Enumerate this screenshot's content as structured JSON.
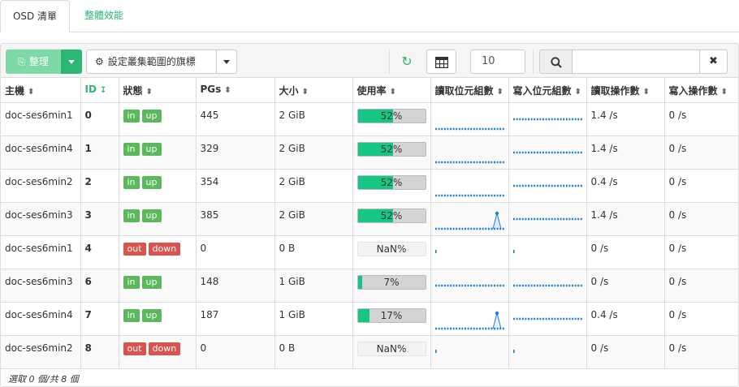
{
  "tabs": [
    {
      "label": "OSD 清單",
      "active": true
    },
    {
      "label": "整體效能",
      "active": false
    }
  ],
  "toolbar": {
    "scrub_label": "整理",
    "flags_label": "設定叢集範圍的旗標",
    "page_size": "10",
    "search_placeholder": ""
  },
  "colors": {
    "accent": "#2bb673",
    "ok": "#5cb85c",
    "bad": "#d9534f",
    "usage_fill": "#16c784",
    "sparkline": "#1f7fd6"
  },
  "icons": {
    "scrub": "broom-icon",
    "flags": "gear-icon",
    "refresh": "refresh-icon",
    "columns": "table-icon",
    "search": "search-icon",
    "clear": "close-icon"
  },
  "columns": [
    "主機",
    "ID",
    "狀態",
    "PGs",
    "大小",
    "使用率",
    "讀取位元組數",
    "寫入位元組數",
    "讀取操作數",
    "寫入操作數"
  ],
  "sorted_column": "ID",
  "rows": [
    {
      "host": "doc-ses6min1",
      "id": "0",
      "status": [
        "in",
        "up"
      ],
      "pgs": "445",
      "size": "2 GiB",
      "usage": 52,
      "usage_text": "52%",
      "read_bytes": "flat",
      "write_bytes": "dense",
      "read_ops": "1.4 /s",
      "write_ops": "0 /s"
    },
    {
      "host": "doc-ses6min4",
      "id": "1",
      "status": [
        "in",
        "up"
      ],
      "pgs": "329",
      "size": "2 GiB",
      "usage": 52,
      "usage_text": "52%",
      "read_bytes": "flat",
      "write_bytes": "dense",
      "read_ops": "1.4 /s",
      "write_ops": "0 /s"
    },
    {
      "host": "doc-ses6min2",
      "id": "2",
      "status": [
        "in",
        "up"
      ],
      "pgs": "354",
      "size": "2 GiB",
      "usage": 52,
      "usage_text": "52%",
      "read_bytes": "flat",
      "write_bytes": "dense",
      "read_ops": "0.4 /s",
      "write_ops": "0 /s"
    },
    {
      "host": "doc-ses6min3",
      "id": "3",
      "status": [
        "in",
        "up"
      ],
      "pgs": "385",
      "size": "2 GiB",
      "usage": 52,
      "usage_text": "52%",
      "read_bytes": "spike",
      "write_bytes": "dense",
      "read_ops": "1.4 /s",
      "write_ops": "0 /s"
    },
    {
      "host": "doc-ses6min1",
      "id": "4",
      "status": [
        "out",
        "down"
      ],
      "pgs": "0",
      "size": "0 B",
      "usage": null,
      "usage_text": "NaN%",
      "read_bytes": "dot",
      "write_bytes": "dot",
      "read_ops": "0 /s",
      "write_ops": "0 /s"
    },
    {
      "host": "doc-ses6min3",
      "id": "6",
      "status": [
        "in",
        "up"
      ],
      "pgs": "148",
      "size": "1 GiB",
      "usage": 7,
      "usage_text": "7%",
      "read_bytes": "dense",
      "write_bytes": "dense",
      "read_ops": "0 /s",
      "write_ops": "0 /s"
    },
    {
      "host": "doc-ses6min4",
      "id": "7",
      "status": [
        "in",
        "up"
      ],
      "pgs": "187",
      "size": "1 GiB",
      "usage": 17,
      "usage_text": "17%",
      "read_bytes": "spike",
      "write_bytes": "dense",
      "read_ops": "0.4 /s",
      "write_ops": "0 /s"
    },
    {
      "host": "doc-ses6min2",
      "id": "8",
      "status": [
        "out",
        "down"
      ],
      "pgs": "0",
      "size": "0 B",
      "usage": null,
      "usage_text": "NaN%",
      "read_bytes": "dot",
      "write_bytes": "dot",
      "read_ops": "0 /s",
      "write_ops": "0 /s"
    }
  ],
  "footer": "選取 0 個/共 8 個"
}
